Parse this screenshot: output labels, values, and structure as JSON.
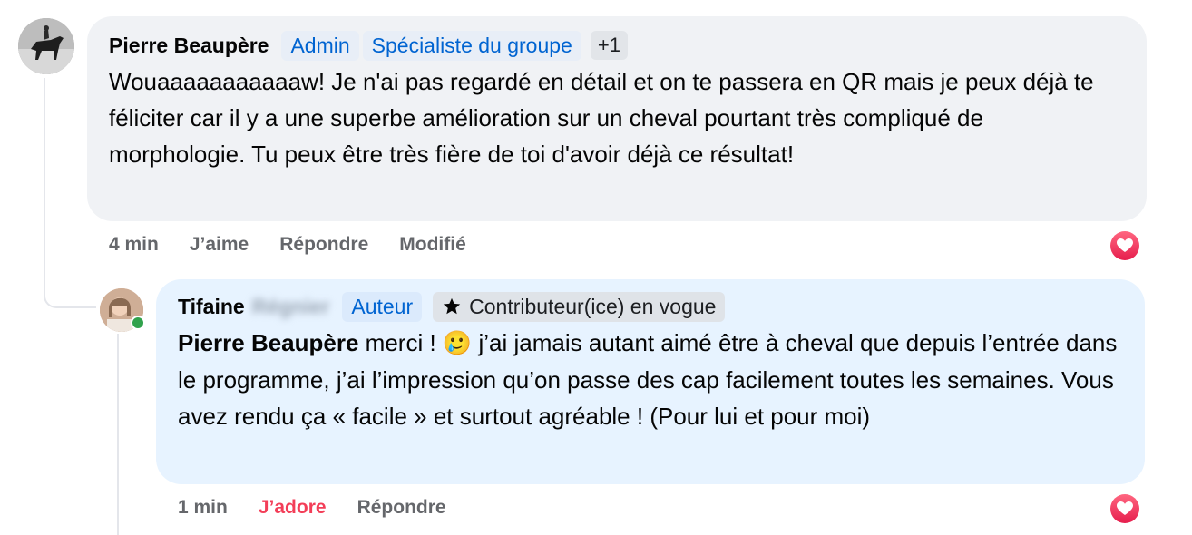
{
  "comments": [
    {
      "author": "Pierre Beaupère",
      "badges": [
        "Admin",
        "Spécialiste du groupe"
      ],
      "extra_badges": "+1",
      "text": "Wouaaaaaaaaaaaw! Je n'ai pas regardé en détail et on te passera en QR mais je peux déjà te féliciter car il y a une superbe amélioration sur un cheval pourtant très compliqué de morphologie. Tu peux être très fière de toi d'avoir déjà ce résultat!",
      "time": "4 min",
      "like_label": "J’aime",
      "reply_label": "Répondre",
      "edited_label": "Modifié",
      "reaction_icon": "heart-reaction-icon"
    },
    {
      "author": "Tifaine",
      "author_surname_blurred": "Régnier",
      "badge_author": "Auteur",
      "badge_top": "Contributeur(ice) en vogue",
      "mention": "Pierre Beaupère",
      "text_before_emoji": " merci ! ",
      "emoji": "🥲",
      "text_after_emoji": " j’ai jamais autant aimé être à cheval que depuis l’entrée dans le programme, j’ai l’impression qu’on passe des cap facilement toutes les semaines. Vous avez rendu ça « facile » et surtout agréable ! (Pour lui et pour moi)",
      "time": "1 min",
      "like_label": "J’adore",
      "reply_label": "Répondre",
      "reaction_icon": "heart-reaction-icon",
      "online": true
    }
  ],
  "colors": {
    "link_blue": "#0064d1",
    "love_red": "#f33e58",
    "bubble_gray": "#f0f2f5",
    "bubble_blue": "#e7f3ff",
    "online_green": "#31a24c"
  }
}
